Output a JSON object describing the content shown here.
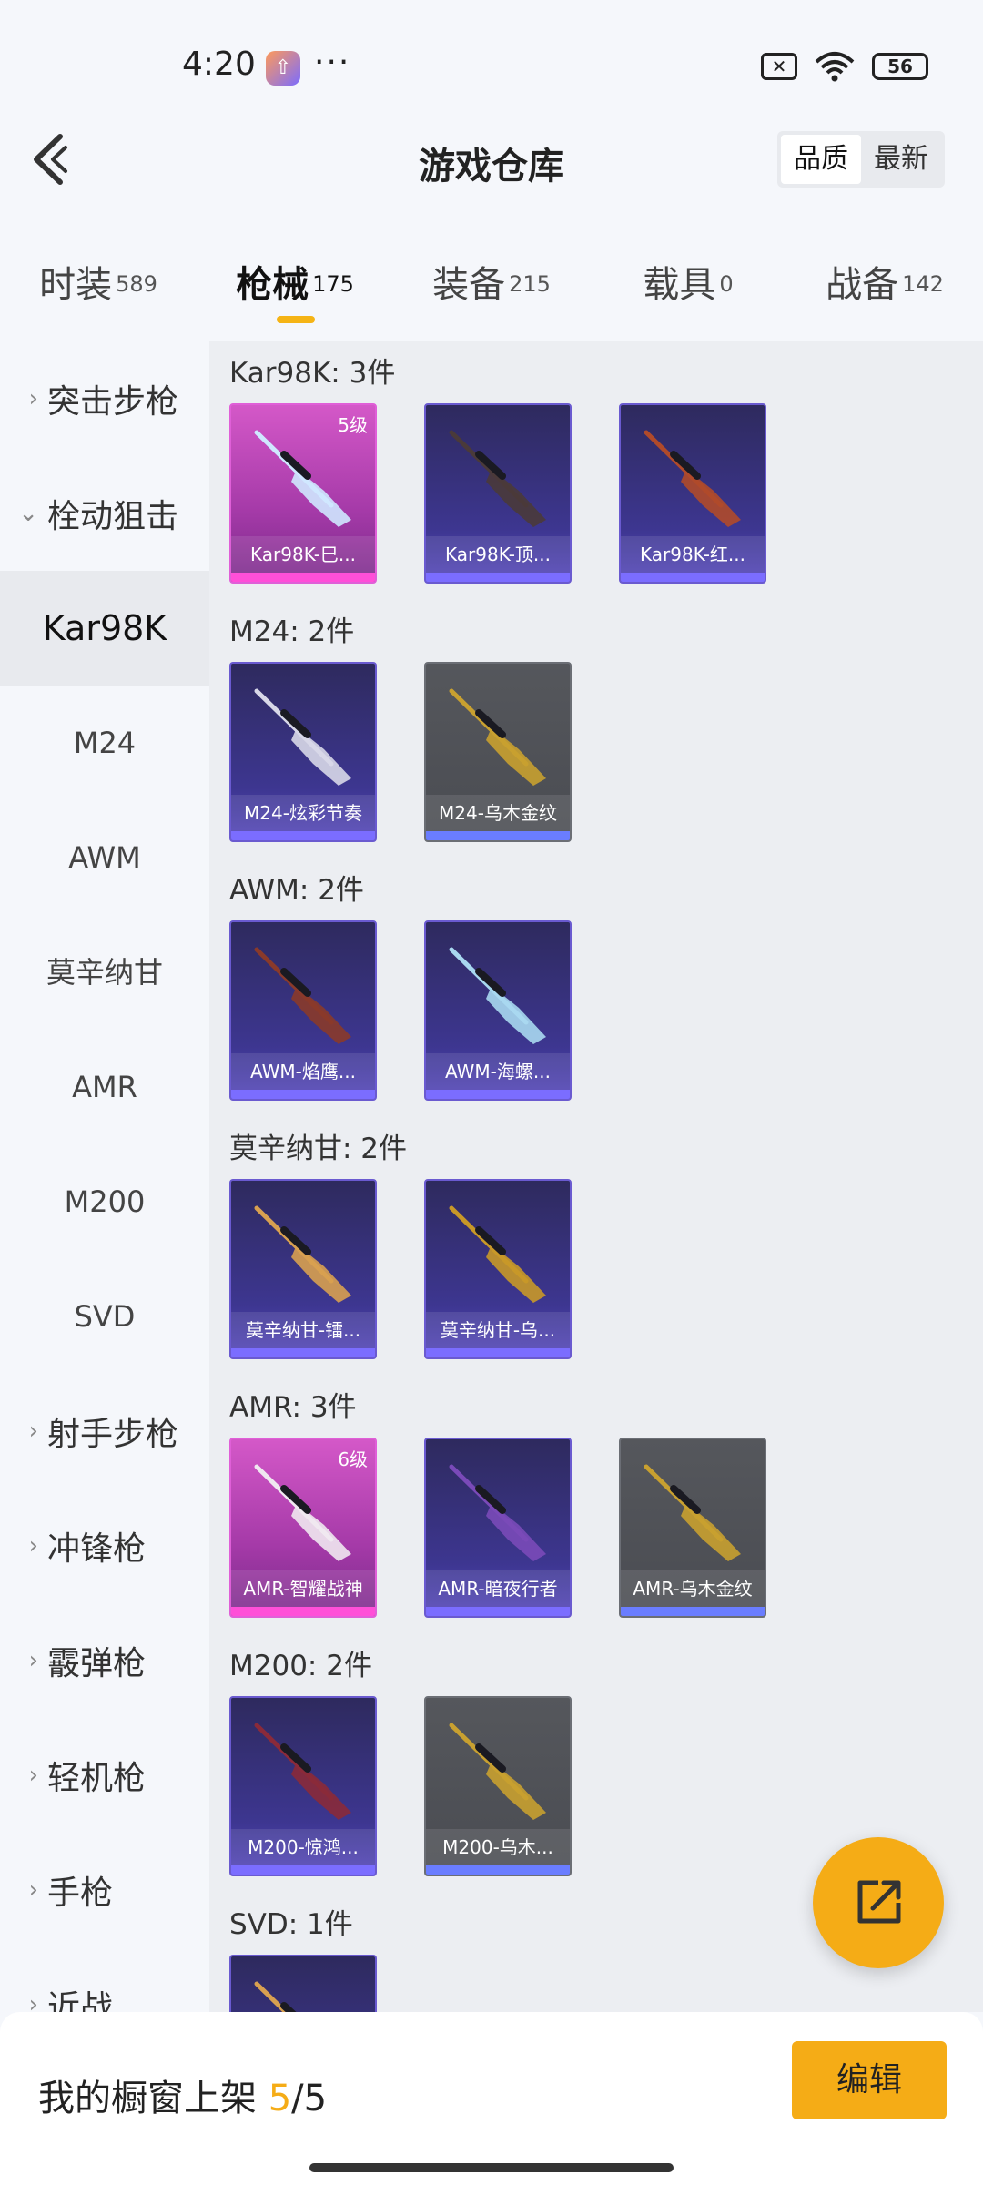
{
  "status_bar": {
    "time": "4:20",
    "battery": "56",
    "icons": [
      "app-update-icon",
      "more-dots-icon",
      "sim-off-icon",
      "wifi-icon",
      "battery-icon"
    ]
  },
  "header": {
    "title": "游戏仓库",
    "sort_options": [
      "品质",
      "最新"
    ],
    "sort_active": "品质"
  },
  "tabs": [
    {
      "label": "时装",
      "count": "589"
    },
    {
      "label": "枪械",
      "count": "175",
      "active": true
    },
    {
      "label": "装备",
      "count": "215"
    },
    {
      "label": "载具",
      "count": "0"
    },
    {
      "label": "战备",
      "count": "142"
    }
  ],
  "sidebar": {
    "items": [
      {
        "label": "突击步枪",
        "type": "category",
        "chevron": "›"
      },
      {
        "label": "栓动狙击",
        "type": "category",
        "chevron": "⌄",
        "expanded": true
      },
      {
        "label": "Kar98K",
        "type": "sub",
        "active": true
      },
      {
        "label": "M24",
        "type": "sub"
      },
      {
        "label": "AWM",
        "type": "sub"
      },
      {
        "label": "莫辛纳甘",
        "type": "sub"
      },
      {
        "label": "AMR",
        "type": "sub"
      },
      {
        "label": "M200",
        "type": "sub"
      },
      {
        "label": "SVD",
        "type": "sub"
      },
      {
        "label": "射手步枪",
        "type": "category",
        "chevron": "›"
      },
      {
        "label": "冲锋枪",
        "type": "category",
        "chevron": "›"
      },
      {
        "label": "霰弹枪",
        "type": "category",
        "chevron": "›"
      },
      {
        "label": "轻机枪",
        "type": "category",
        "chevron": "›"
      },
      {
        "label": "手枪",
        "type": "category",
        "chevron": "›"
      },
      {
        "label": "近战",
        "type": "category",
        "chevron": "›"
      }
    ]
  },
  "groups": [
    {
      "title": "Kar98K: 3件",
      "items": [
        {
          "name": "Kar98K-巳...",
          "rarity": "pink",
          "level": "5级",
          "gun_color": "#cfe8ff"
        },
        {
          "name": "Kar98K-顶...",
          "rarity": "purple",
          "gun_color": "#4a3a3a"
        },
        {
          "name": "Kar98K-红...",
          "rarity": "purple",
          "gun_color": "#b04a2a"
        }
      ]
    },
    {
      "title": "M24: 2件",
      "items": [
        {
          "name": "M24-炫彩节奏",
          "rarity": "purple",
          "gun_color": "#d8d8e8"
        },
        {
          "name": "M24-乌木金纹",
          "rarity": "grey",
          "gun_color": "#c8a030"
        }
      ]
    },
    {
      "title": "AWM: 2件",
      "items": [
        {
          "name": "AWM-焰鹰...",
          "rarity": "purple",
          "gun_color": "#8a3a2a"
        },
        {
          "name": "AWM-海螺...",
          "rarity": "purple",
          "gun_color": "#a8d8f0"
        }
      ]
    },
    {
      "title": "莫辛纳甘: 2件",
      "items": [
        {
          "name": "莫辛纳甘-镭...",
          "rarity": "purple",
          "gun_color": "#d8a050"
        },
        {
          "name": "莫辛纳甘-乌...",
          "rarity": "purple",
          "gun_color": "#c89828"
        }
      ]
    },
    {
      "title": "AMR: 3件",
      "items": [
        {
          "name": "AMR-智耀战神",
          "rarity": "pink",
          "level": "6级",
          "gun_color": "#f0e8f0"
        },
        {
          "name": "AMR-暗夜行者",
          "rarity": "purple",
          "gun_color": "#7a4ab8"
        },
        {
          "name": "AMR-乌木金纹",
          "rarity": "grey",
          "gun_color": "#c8a030"
        }
      ]
    },
    {
      "title": "M200: 2件",
      "items": [
        {
          "name": "M200-惊鸿...",
          "rarity": "purple",
          "gun_color": "#8a2a3a"
        },
        {
          "name": "M200-乌木...",
          "rarity": "grey",
          "gun_color": "#c8a030"
        }
      ]
    },
    {
      "title": "SVD: 1件",
      "items": [
        {
          "name": "",
          "rarity": "purple",
          "gun_color": "#d8a050"
        }
      ]
    }
  ],
  "bottom_bar": {
    "label": "我的橱窗上架",
    "current": "5",
    "separator": "/",
    "total": "5",
    "edit_label": "编辑"
  },
  "colors": {
    "accent": "#f5ac16",
    "tab_underline": "#f5b415",
    "purple_card": "#3d3690",
    "pink_card": "#c24cbc",
    "grey_card": "#4f5156"
  }
}
